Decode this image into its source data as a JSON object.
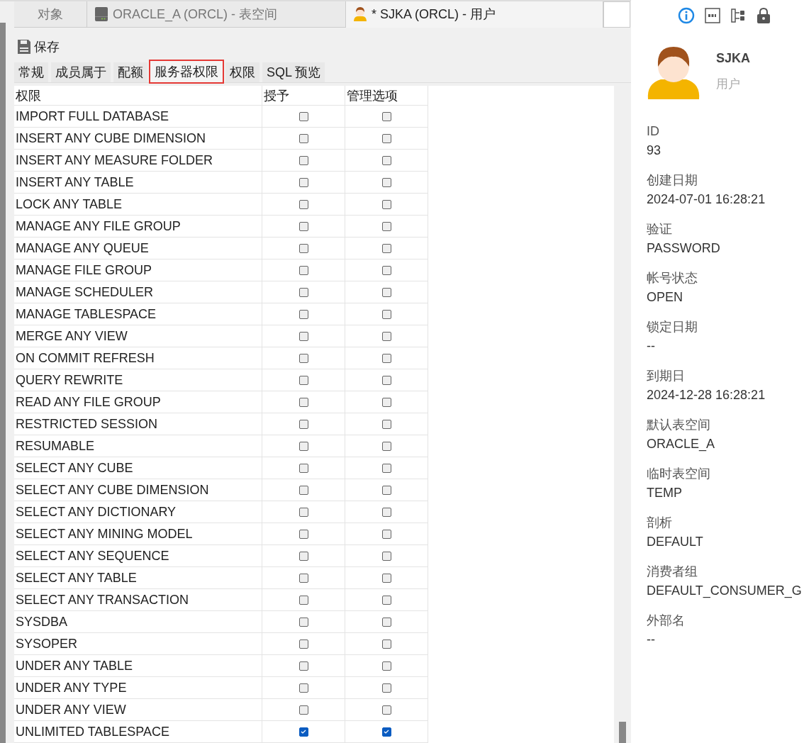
{
  "doc_tabs": [
    {
      "label": "对象",
      "kind": "plain",
      "selected": false
    },
    {
      "label": "ORACLE_A (ORCL) - 表空间",
      "kind": "tablespace",
      "selected": false
    },
    {
      "label": "* SJKA (ORCL) - 用户",
      "kind": "user",
      "selected": true
    }
  ],
  "toolbar": {
    "save": "保存"
  },
  "sub_tabs": [
    {
      "label": "常规",
      "selected": false
    },
    {
      "label": "成员属于",
      "selected": false
    },
    {
      "label": "配额",
      "selected": false
    },
    {
      "label": "服务器权限",
      "selected": true
    },
    {
      "label": "权限",
      "selected": false
    },
    {
      "label": "SQL 预览",
      "selected": false
    }
  ],
  "table": {
    "columns": [
      "权限",
      "授予",
      "管理选项"
    ],
    "rows": [
      {
        "name": "IMPORT FULL DATABASE",
        "grant": false,
        "admin": false
      },
      {
        "name": "INSERT ANY CUBE DIMENSION",
        "grant": false,
        "admin": false
      },
      {
        "name": "INSERT ANY MEASURE FOLDER",
        "grant": false,
        "admin": false
      },
      {
        "name": "INSERT ANY TABLE",
        "grant": false,
        "admin": false
      },
      {
        "name": "LOCK ANY TABLE",
        "grant": false,
        "admin": false
      },
      {
        "name": "MANAGE ANY FILE GROUP",
        "grant": false,
        "admin": false
      },
      {
        "name": "MANAGE ANY QUEUE",
        "grant": false,
        "admin": false
      },
      {
        "name": "MANAGE FILE GROUP",
        "grant": false,
        "admin": false
      },
      {
        "name": "MANAGE SCHEDULER",
        "grant": false,
        "admin": false
      },
      {
        "name": "MANAGE TABLESPACE",
        "grant": false,
        "admin": false
      },
      {
        "name": "MERGE ANY VIEW",
        "grant": false,
        "admin": false
      },
      {
        "name": "ON COMMIT REFRESH",
        "grant": false,
        "admin": false
      },
      {
        "name": "QUERY REWRITE",
        "grant": false,
        "admin": false
      },
      {
        "name": "READ ANY FILE GROUP",
        "grant": false,
        "admin": false
      },
      {
        "name": "RESTRICTED SESSION",
        "grant": false,
        "admin": false
      },
      {
        "name": "RESUMABLE",
        "grant": false,
        "admin": false
      },
      {
        "name": "SELECT ANY CUBE",
        "grant": false,
        "admin": false
      },
      {
        "name": "SELECT ANY CUBE DIMENSION",
        "grant": false,
        "admin": false
      },
      {
        "name": "SELECT ANY DICTIONARY",
        "grant": false,
        "admin": false
      },
      {
        "name": "SELECT ANY MINING MODEL",
        "grant": false,
        "admin": false
      },
      {
        "name": "SELECT ANY SEQUENCE",
        "grant": false,
        "admin": false
      },
      {
        "name": "SELECT ANY TABLE",
        "grant": false,
        "admin": false
      },
      {
        "name": "SELECT ANY TRANSACTION",
        "grant": false,
        "admin": false
      },
      {
        "name": "SYSDBA",
        "grant": false,
        "admin": false
      },
      {
        "name": "SYSOPER",
        "grant": false,
        "admin": false
      },
      {
        "name": "UNDER ANY TABLE",
        "grant": false,
        "admin": false
      },
      {
        "name": "UNDER ANY TYPE",
        "grant": false,
        "admin": false
      },
      {
        "name": "UNDER ANY VIEW",
        "grant": false,
        "admin": false
      },
      {
        "name": "UNLIMITED TABLESPACE",
        "grant": true,
        "admin": true
      }
    ]
  },
  "info_panel": {
    "name": "SJKA",
    "type": "用户",
    "properties": [
      {
        "label": "ID",
        "value": "93"
      },
      {
        "label": "创建日期",
        "value": "2024-07-01 16:28:21"
      },
      {
        "label": "验证",
        "value": "PASSWORD"
      },
      {
        "label": "帐号状态",
        "value": "OPEN"
      },
      {
        "label": "锁定日期",
        "value": "--"
      },
      {
        "label": "到期日",
        "value": "2024-12-28 16:28:21"
      },
      {
        "label": "默认表空间",
        "value": "ORACLE_A"
      },
      {
        "label": "临时表空间",
        "value": "TEMP"
      },
      {
        "label": "剖析",
        "value": "DEFAULT"
      },
      {
        "label": "消费者组",
        "value": "DEFAULT_CONSUMER_G"
      },
      {
        "label": "外部名",
        "value": "--"
      }
    ]
  }
}
